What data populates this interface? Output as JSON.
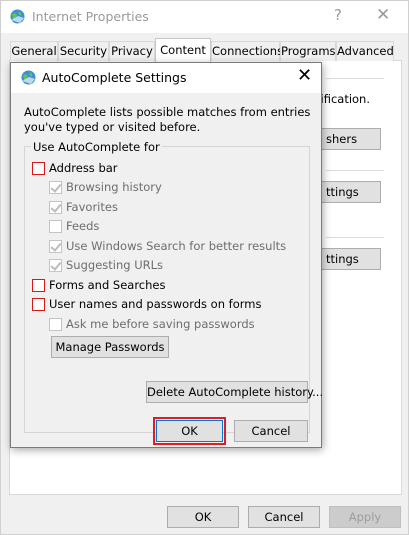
{
  "outer": {
    "title": "Internet Properties",
    "help_glyph": "?",
    "close_glyph": "✕",
    "tabs": [
      {
        "label": "General"
      },
      {
        "label": "Security"
      },
      {
        "label": "Privacy"
      },
      {
        "label": "Content"
      },
      {
        "label": "Connections"
      },
      {
        "label": "Programs"
      },
      {
        "label": "Advanced"
      }
    ],
    "background_text_1": "tification.",
    "background_btn_1": "shers",
    "background_btn_2": "ttings",
    "background_btn_3": "ttings",
    "ok_label": "OK",
    "cancel_label": "Cancel",
    "apply_label": "Apply"
  },
  "dialog": {
    "title": "AutoComplete Settings",
    "close_glyph": "✕",
    "description": "AutoComplete lists possible matches from entries you've typed or visited before.",
    "group_label": "Use AutoComplete for",
    "checkboxes": {
      "address_bar": "Address bar",
      "browsing_history": "Browsing history",
      "favorites": "Favorites",
      "feeds": "Feeds",
      "windows_search": "Use Windows Search for better results",
      "suggesting_urls": "Suggesting URLs",
      "forms_searches": "Forms and Searches",
      "user_names": "User names and passwords on forms",
      "ask_before_saving": "Ask me before saving passwords"
    },
    "manage_passwords_label": "Manage Passwords",
    "delete_history_label": "Delete AutoComplete history...",
    "ok_label": "OK",
    "cancel_label": "Cancel"
  },
  "colors": {
    "highlight_red": "#e11d22",
    "checkbox_red": "#d8191a"
  }
}
